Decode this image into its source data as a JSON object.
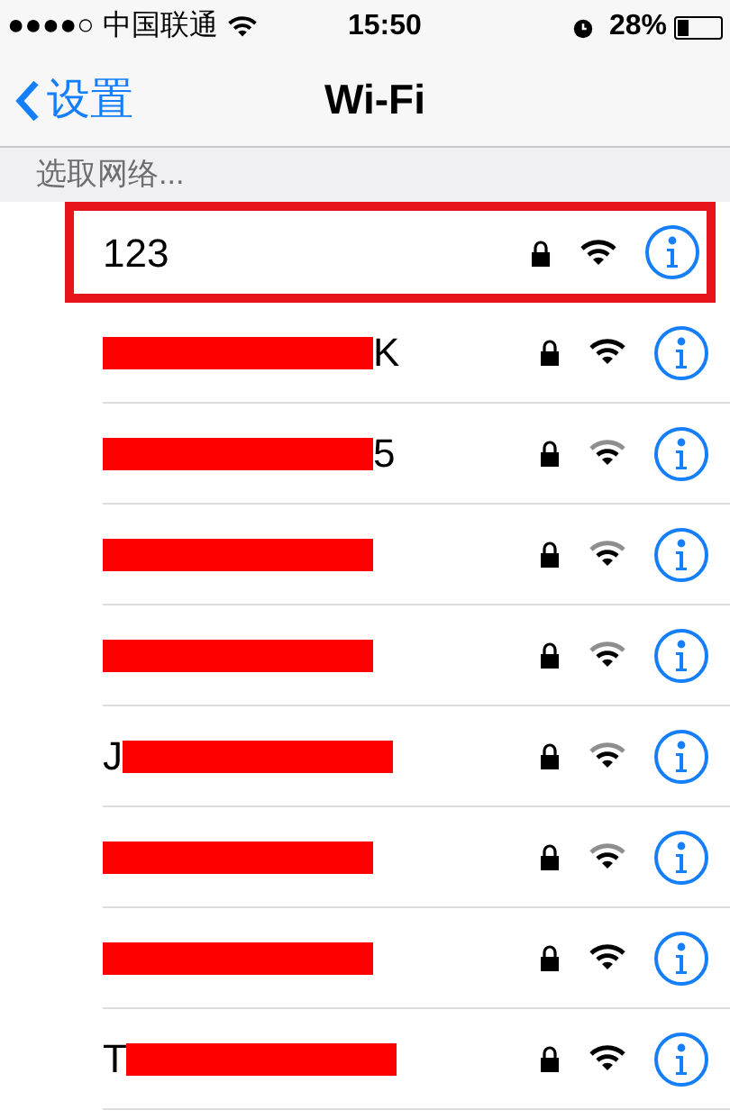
{
  "status_bar": {
    "carrier": "●●●●○ 中国联通",
    "time": "15:50",
    "battery": "28%"
  },
  "nav": {
    "back": "设置",
    "title": "Wi-Fi"
  },
  "section_header": "选取网络...",
  "networks": [
    {
      "name": "123",
      "redacted": false,
      "locked": true,
      "weak_signal": false,
      "highlighted": true
    },
    {
      "name": "K",
      "fragment_first": false,
      "redacted": true,
      "locked": true,
      "weak_signal": false,
      "highlighted": false
    },
    {
      "name": "5",
      "fragment_first": false,
      "redacted": true,
      "locked": true,
      "weak_signal": true,
      "highlighted": false
    },
    {
      "redacted": true,
      "locked": true,
      "weak_signal": true,
      "highlighted": false
    },
    {
      "redacted": true,
      "locked": true,
      "weak_signal": true,
      "highlighted": false
    },
    {
      "name": "J",
      "fragment_first": true,
      "redacted": true,
      "locked": true,
      "weak_signal": true,
      "highlighted": false
    },
    {
      "redacted": true,
      "locked": true,
      "weak_signal": true,
      "highlighted": false
    },
    {
      "redacted": true,
      "locked": true,
      "weak_signal": false,
      "highlighted": false
    },
    {
      "name": "T",
      "fragment_first": true,
      "redacted": true,
      "locked": true,
      "weak_signal": false,
      "highlighted": false
    }
  ]
}
